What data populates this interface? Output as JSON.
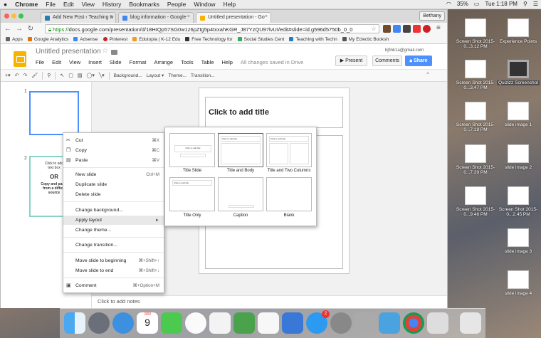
{
  "menubar": {
    "apple": "",
    "app": "Chrome",
    "items": [
      "File",
      "Edit",
      "View",
      "History",
      "Bookmarks",
      "People",
      "Window",
      "Help"
    ],
    "battery": "35%",
    "clock": "Tue 1:18 PM"
  },
  "browser": {
    "tabs": [
      {
        "label": "Add New Post ‹ Teaching w",
        "color": "#2b7bb9"
      },
      {
        "label": "blog information - Google",
        "color": "#4285f4"
      },
      {
        "label": "Untitled presentation - Go",
        "color": "#f4b400",
        "active": true
      }
    ],
    "user": "Bethany",
    "url_scheme": "https://",
    "url_rest": "docs.google.com/presentation/d/18HIQp57SG0w1z6pZtg5p4txxahKGR_J87YzQU97lvUI/edit#slide=id.g596d5750b_0_0",
    "bookmarks": [
      {
        "label": "Apps",
        "color": "#666"
      },
      {
        "label": "Google Analytics",
        "color": "#e37400"
      },
      {
        "label": "Adsense",
        "color": "#4285f4"
      },
      {
        "label": "Pinterest",
        "color": "#cb2027"
      },
      {
        "label": "Edutopia | K-12 Edu",
        "color": "#f29b1f"
      },
      {
        "label": "Free Technology for",
        "color": "#333"
      },
      {
        "label": "Social Studies Cent",
        "color": "#3a6"
      },
      {
        "label": "Teaching with Techn",
        "color": "#2b7bb9"
      },
      {
        "label": "My Eclectic Booksh",
        "color": "#555"
      }
    ]
  },
  "slides": {
    "doc_title": "Untitled presentation",
    "email": "bjfink1a@gmail.com",
    "present": "Present",
    "comments": "Comments",
    "share": "Share",
    "menus": [
      "File",
      "Edit",
      "View",
      "Insert",
      "Slide",
      "Format",
      "Arrange",
      "Tools",
      "Table",
      "Help"
    ],
    "saved": "All changes saved in Drive",
    "toolbar": {
      "background": "Background...",
      "layout": "Layout",
      "theme": "Theme...",
      "transition": "Transition..."
    },
    "thumbs": [
      {
        "num": "1"
      },
      {
        "num": "2",
        "line1": "Click to add",
        "line2": "text box",
        "or": "OR",
        "line3": "Copy and paste",
        "line4": "from a differe",
        "line5": "source"
      }
    ],
    "slide_title": "Click to add title",
    "notes": "Click to add notes"
  },
  "context_menu": [
    {
      "label": "Cut",
      "shortcut": "⌘X",
      "icon": "✂"
    },
    {
      "label": "Copy",
      "shortcut": "⌘C",
      "icon": "❐"
    },
    {
      "label": "Paste",
      "shortcut": "⌘V",
      "icon": "▤"
    },
    {
      "label": "New slide",
      "shortcut": "Ctrl+M"
    },
    {
      "label": "Duplicate slide",
      "shortcut": ""
    },
    {
      "label": "Delete slide",
      "shortcut": ""
    },
    {
      "label": "Change background...",
      "shortcut": ""
    },
    {
      "label": "Apply layout",
      "shortcut": "►",
      "highlight": true
    },
    {
      "label": "Change theme...",
      "shortcut": ""
    },
    {
      "label": "Change transition...",
      "shortcut": ""
    },
    {
      "label": "Move slide to beginning",
      "shortcut": "⌘+Shift+↑"
    },
    {
      "label": "Move slide to end",
      "shortcut": "⌘+Shift+↓"
    },
    {
      "label": "Comment",
      "shortcut": "⌘+Option+M",
      "icon": "▣"
    }
  ],
  "layouts": [
    {
      "label": "Title Slide",
      "mini": "Click to add title"
    },
    {
      "label": "Title and Body",
      "mini": "Click to add title",
      "selected": true
    },
    {
      "label": "Title and Two Columns",
      "mini": "Click to add title"
    },
    {
      "label": "Title Only",
      "mini": "Click to add title"
    },
    {
      "label": "Caption",
      "mini": ""
    },
    {
      "label": "Blank",
      "mini": ""
    }
  ],
  "desktop": [
    {
      "label": "Screen Shot 2015-0...3.12 PM"
    },
    {
      "label": "Experience Points"
    },
    {
      "label": "Screen Shot 2015-0...3.47 PM"
    },
    {
      "label": "Quizizz Screenshot"
    },
    {
      "label": "Screen Shot 2015-0...7.19 PM"
    },
    {
      "label": "slide image 1"
    },
    {
      "label": "Screen Shot 2015-0...7.39 PM"
    },
    {
      "label": "slide image 2"
    },
    {
      "label": "Screen Shot 2015-0...9.46 PM"
    },
    {
      "label": "Screen Shot 2015-0...2.45 PM"
    },
    {
      "label": "slide image 3"
    },
    {
      "label": "slide image 4"
    }
  ],
  "dock": {
    "calendar_month": "JUN",
    "calendar_day": "9",
    "appstore_badge": "2"
  }
}
